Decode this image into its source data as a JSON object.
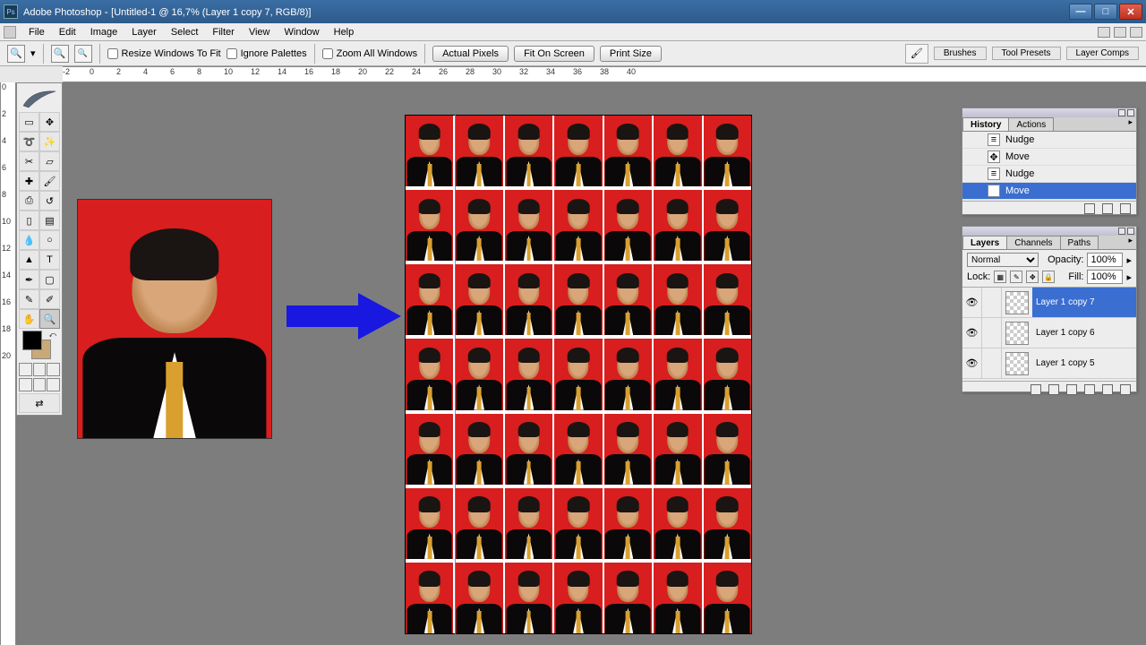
{
  "titlebar": {
    "app": "Adobe Photoshop",
    "doc": "[Untitled-1 @ 16,7% (Layer 1 copy 7, RGB/8)]"
  },
  "menu": [
    "File",
    "Edit",
    "Image",
    "Layer",
    "Select",
    "Filter",
    "View",
    "Window",
    "Help"
  ],
  "options": {
    "resize": "Resize Windows To Fit",
    "ignore": "Ignore Palettes",
    "zoomall": "Zoom All Windows",
    "btn1": "Actual Pixels",
    "btn2": "Fit On Screen",
    "btn3": "Print Size",
    "pal1": "Brushes",
    "pal2": "Tool Presets",
    "pal3": "Layer Comps"
  },
  "ruler_h": [
    -2,
    0,
    2,
    4,
    6,
    8,
    10,
    12,
    14,
    16,
    18,
    20,
    22,
    24,
    26,
    28,
    30,
    32,
    34,
    36,
    38,
    40
  ],
  "ruler_v": [
    0,
    2,
    4,
    6,
    8,
    10,
    12,
    14,
    16,
    18,
    20
  ],
  "historyPanel": {
    "tabs": [
      "History",
      "Actions"
    ],
    "items": [
      {
        "icon": "nudge",
        "label": "Nudge",
        "sel": false
      },
      {
        "icon": "move",
        "label": "Move",
        "sel": false
      },
      {
        "icon": "nudge",
        "label": "Nudge",
        "sel": false
      },
      {
        "icon": "move",
        "label": "Move",
        "sel": true
      }
    ]
  },
  "layersPanel": {
    "tabs": [
      "Layers",
      "Channels",
      "Paths"
    ],
    "blend": "Normal",
    "opacityLabel": "Opacity:",
    "opacity": "100%",
    "lockLabel": "Lock:",
    "fillLabel": "Fill:",
    "fill": "100%",
    "items": [
      {
        "name": "Layer 1 copy 7",
        "sel": true
      },
      {
        "name": "Layer 1 copy 6",
        "sel": false
      },
      {
        "name": "Layer 1 copy 5",
        "sel": false
      }
    ]
  },
  "grid": {
    "rows": 7,
    "cols": 7
  }
}
